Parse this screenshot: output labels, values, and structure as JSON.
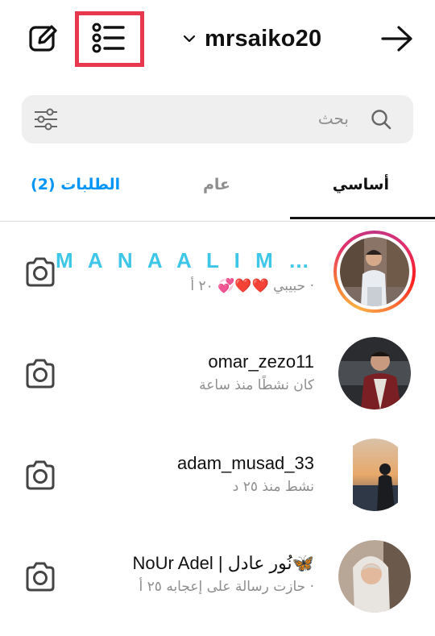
{
  "header": {
    "username": "mrsaiko20"
  },
  "search": {
    "placeholder": "بحث"
  },
  "tabs": {
    "primary": "أساسي",
    "general": "عام",
    "requests": "الطلبات (2)"
  },
  "threads": [
    {
      "name": "M A N A A L I M …",
      "subtitle": "· حبيبي ❤️❤️💞 ٢٠ أ"
    },
    {
      "name": "omar_zezo11",
      "subtitle": "كان نشطًا منذ ساعة"
    },
    {
      "name": "adam_musad_33",
      "subtitle": "نشط منذ ٢٥ د"
    },
    {
      "name": "NoUr Adel | نُور عادل🦋",
      "subtitle": "· حازت رسالة على إعجابه ٢٥ أ"
    }
  ],
  "colors": {
    "accent_blue": "#0095f6",
    "highlight_red": "#e8374e",
    "name_cyan": "#3ec6e8"
  }
}
